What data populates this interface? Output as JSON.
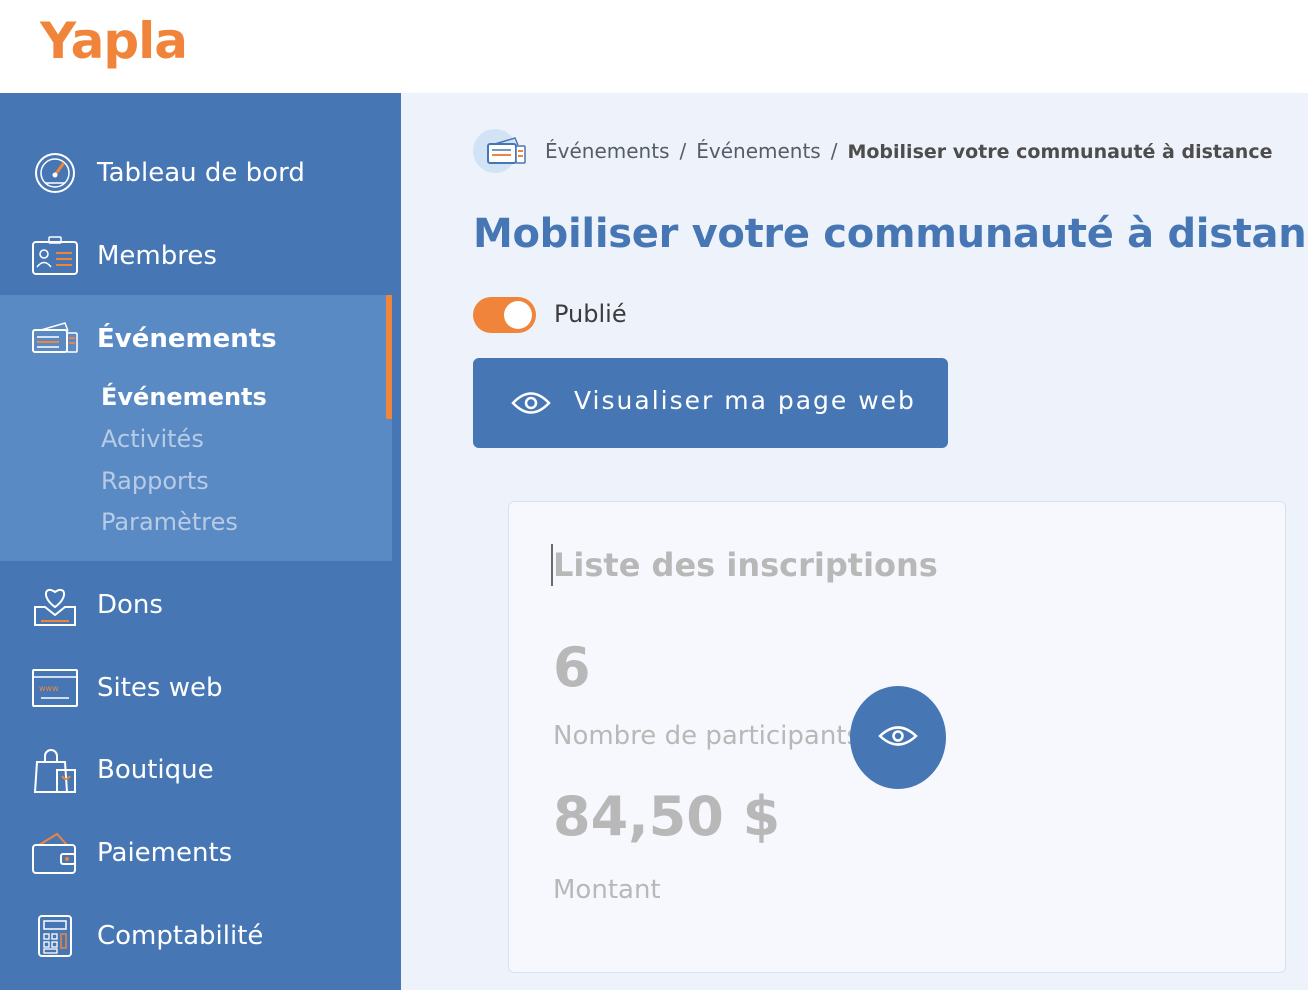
{
  "brand": {
    "logo_text": "Yapla",
    "color": "#f0843a"
  },
  "sidebar": {
    "items": [
      {
        "label": "Tableau de bord",
        "icon": "dashboard-gauge-icon"
      },
      {
        "label": "Membres",
        "icon": "member-card-icon"
      },
      {
        "label": "Événements",
        "icon": "tickets-icon",
        "active": true
      },
      {
        "label": "Dons",
        "icon": "donation-heart-icon"
      },
      {
        "label": "Sites web",
        "icon": "website-icon"
      },
      {
        "label": "Boutique",
        "icon": "shopping-bag-icon"
      },
      {
        "label": "Paiements",
        "icon": "wallet-icon"
      },
      {
        "label": "Comptabilité",
        "icon": "calculator-icon"
      }
    ],
    "subitems": [
      {
        "label": "Événements",
        "current": true
      },
      {
        "label": "Activités"
      },
      {
        "label": "Rapports"
      },
      {
        "label": "Paramètres"
      }
    ]
  },
  "breadcrumb": {
    "icon": "tickets-icon",
    "items": [
      "Événements",
      "Événements",
      "Mobiliser votre communauté à distance"
    ],
    "separator": "/"
  },
  "page": {
    "title": "Mobiliser votre communauté à distance",
    "published_label": "Publié",
    "published": true,
    "view_button_label": "Visualiser ma page web"
  },
  "card": {
    "title": "Liste des inscriptions",
    "participants_count": "6",
    "participants_label": "Nombre de participants",
    "amount_value": "84,50 $",
    "amount_label": "Montant"
  },
  "colors": {
    "sidebar": "#4677b4",
    "accent": "#f0843a",
    "primary": "#4677b4"
  }
}
